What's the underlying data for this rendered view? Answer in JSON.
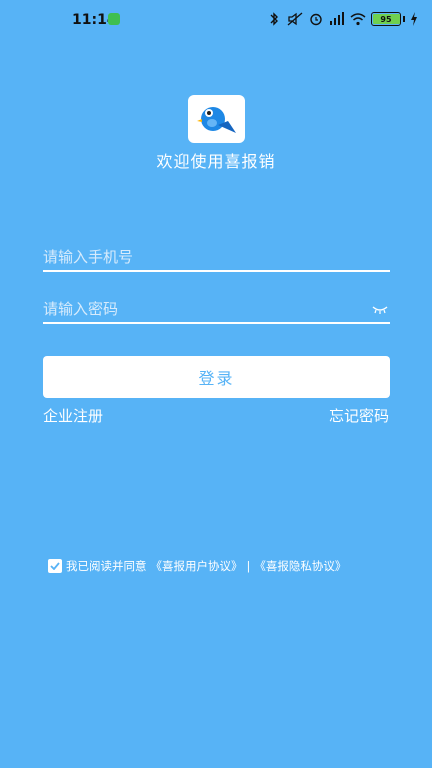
{
  "status_bar": {
    "time": "11:14",
    "battery_level": "95",
    "battery_fraction": 0.95
  },
  "app": {
    "welcome": "欢迎使用喜报销",
    "logo_icon": "bird-logo-icon"
  },
  "form": {
    "phone_placeholder": "请输入手机号",
    "password_placeholder": "请输入密码",
    "login_label": "登录",
    "register_link": "企业注册",
    "forgot_link": "忘记密码"
  },
  "agreement": {
    "checked": true,
    "text": "我已阅读并同意",
    "user_agreement": "《喜报用户协议》",
    "separator": "|",
    "privacy_agreement": "《喜报隐私协议》"
  },
  "colors": {
    "background": "#57b3f6",
    "button_text": "#57b3f6",
    "logo_bird": "#1e88e5"
  }
}
